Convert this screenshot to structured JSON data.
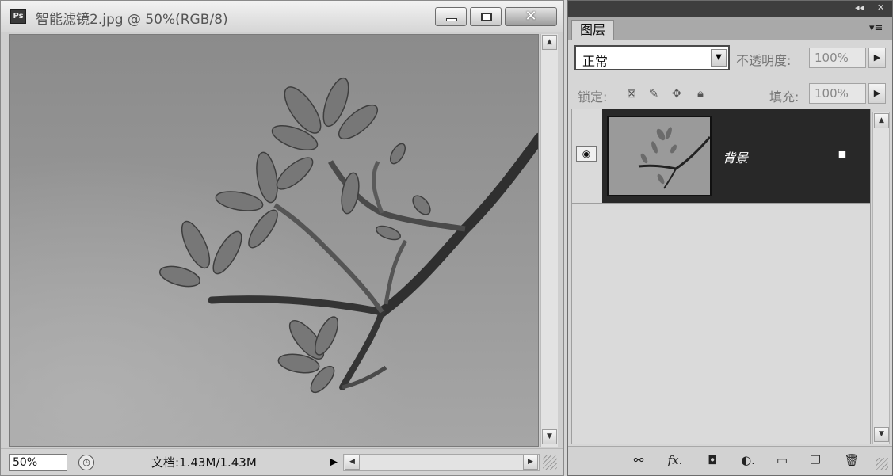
{
  "document": {
    "title": "智能滤镜2.jpg @ 50%(RGB/8)",
    "app_icon_label": "Ps",
    "zoom": "50%",
    "doc_info": "文档:1.43M/1.43M",
    "buttons": {
      "minimize": "minimize-icon",
      "restore": "restore-icon",
      "close": "close-icon"
    }
  },
  "panel": {
    "topbar": {
      "collapse_glyph": "◂◂",
      "close_glyph": "✕"
    },
    "tab_label": "图层",
    "menu_glyph": "▾≡",
    "blend_mode": "正常",
    "opacity_label": "不透明度:",
    "opacity_value": "100%",
    "lock_label": "锁定:",
    "fill_label": "填充:",
    "fill_value": "100%",
    "layers": [
      {
        "name": "背景",
        "visible": true,
        "locked": true
      }
    ]
  },
  "colors": {
    "panel_dark": "#282828",
    "chrome": "#d4d4d4",
    "sky": "#999999"
  }
}
